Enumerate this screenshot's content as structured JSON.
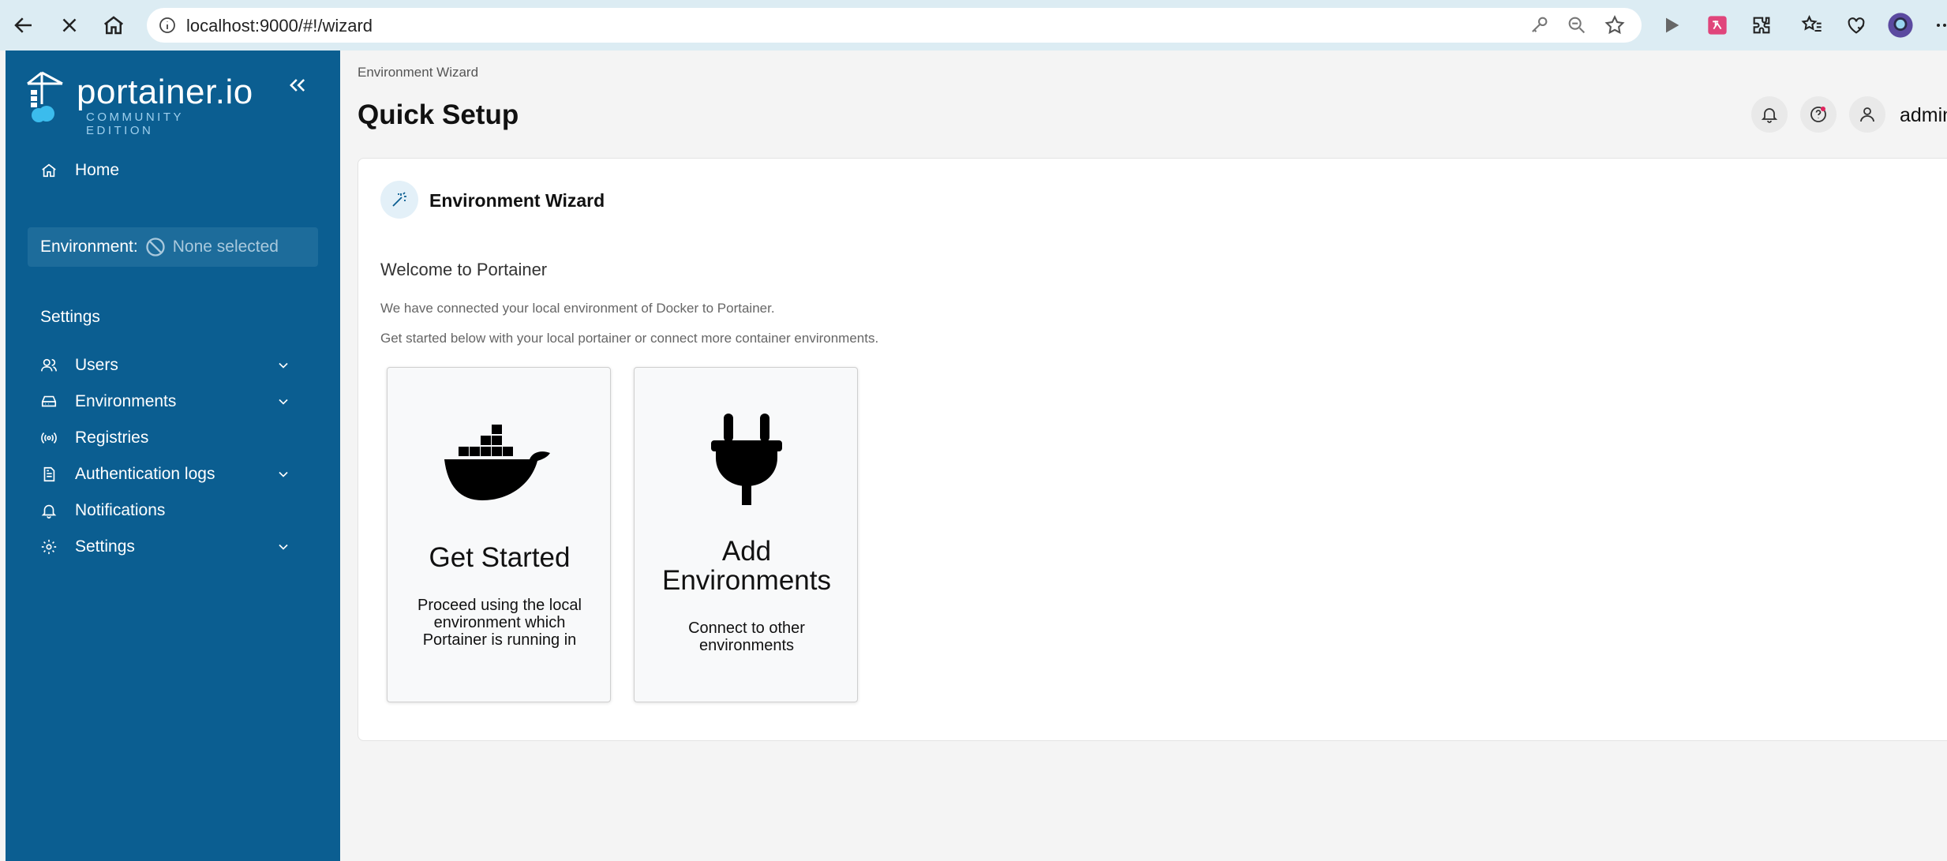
{
  "browser": {
    "url": "localhost:9000/#!/wizard"
  },
  "sidebar": {
    "logo_text": "portainer.io",
    "logo_sub": "COMMUNITY EDITION",
    "home_label": "Home",
    "environment_label": "Environment:",
    "environment_value": "None selected",
    "section_title": "Settings",
    "items": [
      {
        "label": "Users",
        "icon": "users-icon",
        "has_chevron": true
      },
      {
        "label": "Environments",
        "icon": "environments-icon",
        "has_chevron": true
      },
      {
        "label": "Registries",
        "icon": "registries-icon",
        "has_chevron": false
      },
      {
        "label": "Authentication logs",
        "icon": "file-text-icon",
        "has_chevron": true
      },
      {
        "label": "Notifications",
        "icon": "bell-icon",
        "has_chevron": false
      },
      {
        "label": "Settings",
        "icon": "gear-icon",
        "has_chevron": true
      }
    ]
  },
  "header": {
    "breadcrumb": "Environment Wizard",
    "title": "Quick Setup",
    "user_name": "admin"
  },
  "wizard": {
    "title": "Environment Wizard",
    "welcome": "Welcome to Portainer",
    "intro_line1": "We have connected your local environment of Docker to Portainer.",
    "intro_line2": "Get started below with your local portainer or connect more container environments.",
    "options": [
      {
        "title": "Get Started",
        "description": "Proceed using the local environment which Portainer is running in",
        "icon": "docker-whale-icon"
      },
      {
        "title": "Add Environments",
        "description": "Connect to other environments",
        "icon": "plug-icon"
      }
    ]
  },
  "colors": {
    "sidebar_bg": "#0b5e91",
    "browser_bar": "#dcecf3",
    "accent": "#0b5e91"
  }
}
